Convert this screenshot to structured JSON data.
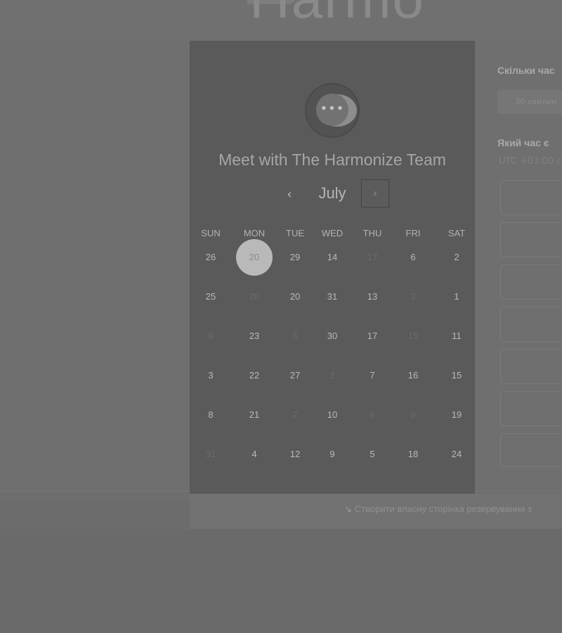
{
  "header": {
    "brand_text": "Harmo"
  },
  "calendar": {
    "title": "Meet with The Harmonize Team",
    "month": "July",
    "prev_glyph": "‹",
    "next_glyph": "›",
    "days_of_week": [
      "SUN",
      "MON",
      "TUE",
      "WED",
      "THU",
      "FRI",
      "SAT"
    ],
    "weeks": [
      [
        {
          "d": "26"
        },
        {
          "d": "20",
          "selected": true
        },
        {
          "d": "29"
        },
        {
          "d": "14"
        },
        {
          "d": "17",
          "dim": true
        },
        {
          "d": "6"
        },
        {
          "d": "2"
        }
      ],
      [
        {
          "d": "25"
        },
        {
          "d": "28",
          "dim": true
        },
        {
          "d": "20"
        },
        {
          "d": "31"
        },
        {
          "d": "13"
        },
        {
          "d": "3",
          "dim": true
        },
        {
          "d": "1"
        }
      ],
      [
        {
          "d": "9",
          "dim": true
        },
        {
          "d": "23"
        },
        {
          "d": "6",
          "dim": true
        },
        {
          "d": "30"
        },
        {
          "d": "17"
        },
        {
          "d": "15",
          "dim": true
        },
        {
          "d": "11"
        }
      ],
      [
        {
          "d": "3"
        },
        {
          "d": "22"
        },
        {
          "d": "27"
        },
        {
          "d": "2",
          "dim": true
        },
        {
          "d": "7"
        },
        {
          "d": "16"
        },
        {
          "d": "15"
        }
      ],
      [
        {
          "d": "8"
        },
        {
          "d": "21"
        },
        {
          "d": "2",
          "dim": true
        },
        {
          "d": "10"
        },
        {
          "d": "9",
          "dim": true
        },
        {
          "d": "9",
          "dim": true
        },
        {
          "d": "19"
        }
      ],
      [
        {
          "d": "31",
          "dim": true
        },
        {
          "d": "4"
        },
        {
          "d": "12"
        },
        {
          "d": "9"
        },
        {
          "d": "5"
        },
        {
          "d": "18"
        },
        {
          "d": "24"
        }
      ]
    ]
  },
  "side": {
    "duration_question": "Скільки час",
    "duration_option": "30 хвилин",
    "time_question": "Який час є",
    "timezone": "UTC +03:00 с"
  },
  "footer": {
    "link_icon": "↘",
    "link_text": "Створити власну сторінка резервування з"
  }
}
